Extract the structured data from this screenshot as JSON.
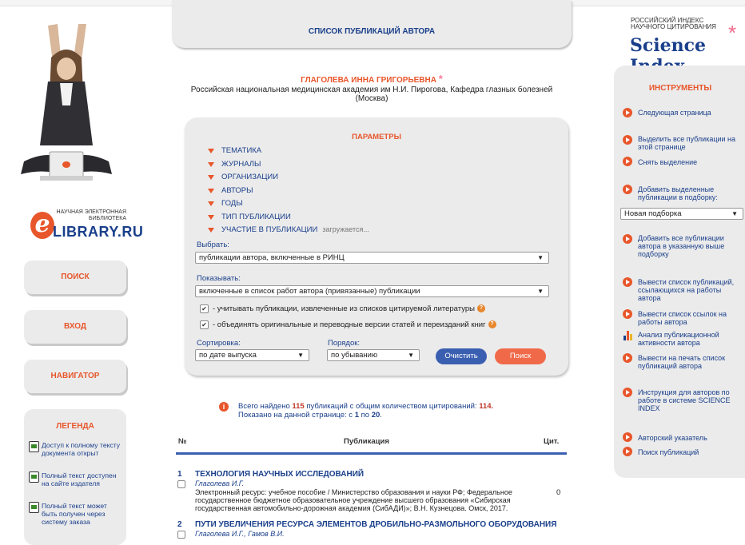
{
  "header": {
    "title": "СПИСОК ПУБЛИКАЦИЙ АВТОРА"
  },
  "author": {
    "name": "ГЛАГОЛЕВА ИННА ГРИГОРЬЕВНА",
    "star": "*",
    "affiliation": "Российская национальная медицинская академия им Н.И. Пирогова, Кафедра глазных болезней (Москва)"
  },
  "elibrary": {
    "small": "НАУЧНАЯ ЭЛЕКТРОННАЯ БИБЛИОТЕКА",
    "big": "LIBRARY.RU",
    "letter": "e"
  },
  "nav": {
    "search": "ПОИСК",
    "login": "ВХОД",
    "navigator": "НАВИГАТОР"
  },
  "legend": {
    "title": "ЛЕГЕНДА",
    "items": [
      "Доступ к полному тексту документа открыт",
      "Полный текст доступен на сайте издателя",
      "Полный текст может быть получен через систему заказа"
    ]
  },
  "params": {
    "title": "ПАРАМЕТРЫ",
    "filters": [
      "ТЕМАТИКА",
      "ЖУРНАЛЫ",
      "ОРГАНИЗАЦИИ",
      "АВТОРЫ",
      "ГОДЫ",
      "ТИП ПУБЛИКАЦИИ",
      "УЧАСТИЕ В ПУБЛИКАЦИИ"
    ],
    "loading": "загружается...",
    "select_label": "Выбрать:",
    "select_value": "публикации автора, включенные в РИНЦ",
    "show_label": "Показывать:",
    "show_value": "включенные в список работ автора (привязанные) публикации",
    "checkbox1": "- учитывать публикации, извлеченные из списков цитируемой литературы",
    "checkbox2": "- объединять оригинальные и переводные версии статей и переизданий книг",
    "sort_label": "Сортировка:",
    "sort_value": "по дате выпуска",
    "order_label": "Порядок:",
    "order_value": "по убыванию",
    "clear_button": "Очистить",
    "search_button": "Поиск",
    "help": "?"
  },
  "summary": {
    "prefix": "Всего найдено",
    "count": "115",
    "middle": "публикаций с общим количеством цитирований:",
    "citations": "114.",
    "line2_prefix": "Показано на данной странице: с",
    "from": "1",
    "to_word": "по",
    "to": "20",
    "info_icon": "i"
  },
  "table": {
    "col_no": "№",
    "col_pub": "Публикация",
    "col_cit": "Цит.",
    "rows": [
      {
        "num": "1",
        "title": "ТЕХНОЛОГИЯ НАУЧНЫХ ИССЛЕДОВАНИЙ",
        "authors": "Глаголева И.Г.",
        "desc": "Электронный ресурс: учебное пособие / Министерство образования и науки РФ; Федеральное государственное бюджетное образовательное учреждение высшего образования «Сибирская государственная автомобильно-дорожная академия (СибАДИ)»; В.Н. Кузнецова. Омск, 2017.",
        "cit": "0"
      },
      {
        "num": "2",
        "title": "ПУТИ УВЕЛИЧЕНИЯ РЕСУРСА ЭЛЕМЕНТОВ ДРОБИЛЬНО-РАЗМОЛЬНОГО ОБОРУДОВАНИЯ",
        "authors": "Глаголева И.Г., Гамов В.И.",
        "desc": "",
        "cit": ""
      }
    ]
  },
  "science_index": {
    "line1": "РОССИЙСКИЙ ИНДЕКС",
    "line2": "НАУЧНОГО ЦИТИРОВАНИЯ",
    "brand": "Science Index",
    "star": "*"
  },
  "tools": {
    "title": "ИНСТРУМЕНТЫ",
    "next_page": "Следующая страница",
    "select_all": "Выделить все публикации на этой странице",
    "deselect": "Снять выделение",
    "add_selected": "Добавить выделенные публикации в подборку:",
    "collection_value": "Новая подборка",
    "add_all": "Добавить все публикации автора в указанную выше подборку",
    "citing_list": "Вывести список публикаций, ссылающихся на работы автора",
    "refs_list": "Вывести список ссылок на работы автора",
    "activity": "Анализ публикационной активности автора",
    "print_list": "Вывести на печать список публикаций автора",
    "instruction": "Инструкция для авторов по работе в системе SCIENCE INDEX",
    "author_index": "Авторский указатель",
    "pub_search": "Поиск публикаций"
  },
  "colors": {
    "accent": "#e8562b",
    "link": "#1a3f8b",
    "panel": "#ebebeb",
    "clear_btn": "#3b5fb0",
    "search_btn": "#f06a4a"
  }
}
